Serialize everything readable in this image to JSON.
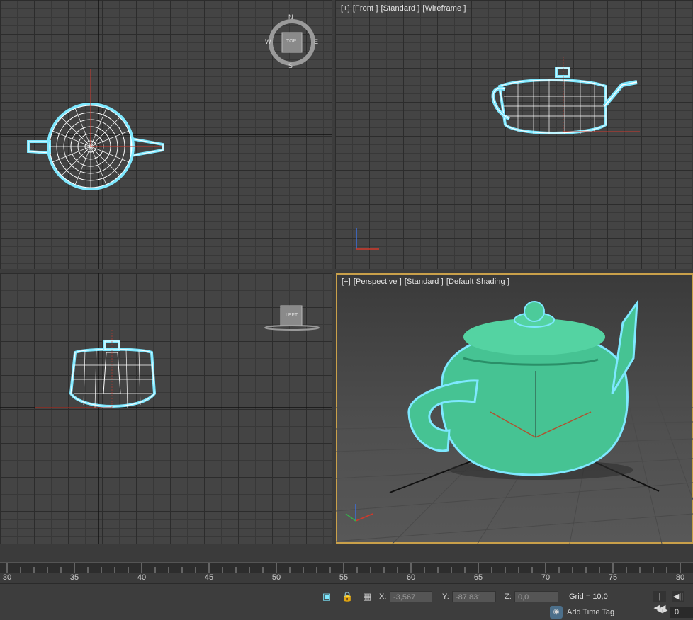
{
  "viewports": {
    "front": {
      "labels": [
        "[+]",
        "[Front ]",
        "[Standard ]",
        "[Wireframe ]"
      ]
    },
    "perspective": {
      "labels": [
        "[+]",
        "[Perspective ]",
        "[Standard ]",
        "[Default Shading ]"
      ]
    }
  },
  "viewcube": {
    "top_face": "TOP",
    "compass": {
      "n": "N",
      "s": "S",
      "w": "W",
      "e": "E"
    },
    "left_face": "LEFT"
  },
  "timeline": {
    "ticks": [
      "30",
      "35",
      "40",
      "45",
      "50",
      "55",
      "60",
      "65",
      "70",
      "75",
      "80"
    ]
  },
  "status": {
    "x_label": "X:",
    "x_value": "-3,567",
    "y_label": "Y:",
    "y_value": "-87,831",
    "z_label": "Z:",
    "z_value": "0,0",
    "grid": "Grid = 10,0",
    "add_time_tag": "Add Time Tag",
    "frame": "0"
  },
  "colors": {
    "teapot": "#46c393",
    "selection": "#7ee8ff",
    "active_border": "#c9a04a"
  },
  "icons": [
    "viewcube-icon",
    "selection-lock-icon",
    "absolute-mode-icon",
    "isolate-icon",
    "go-to-start-icon",
    "previous-frame-icon",
    "time-tag-icon"
  ]
}
